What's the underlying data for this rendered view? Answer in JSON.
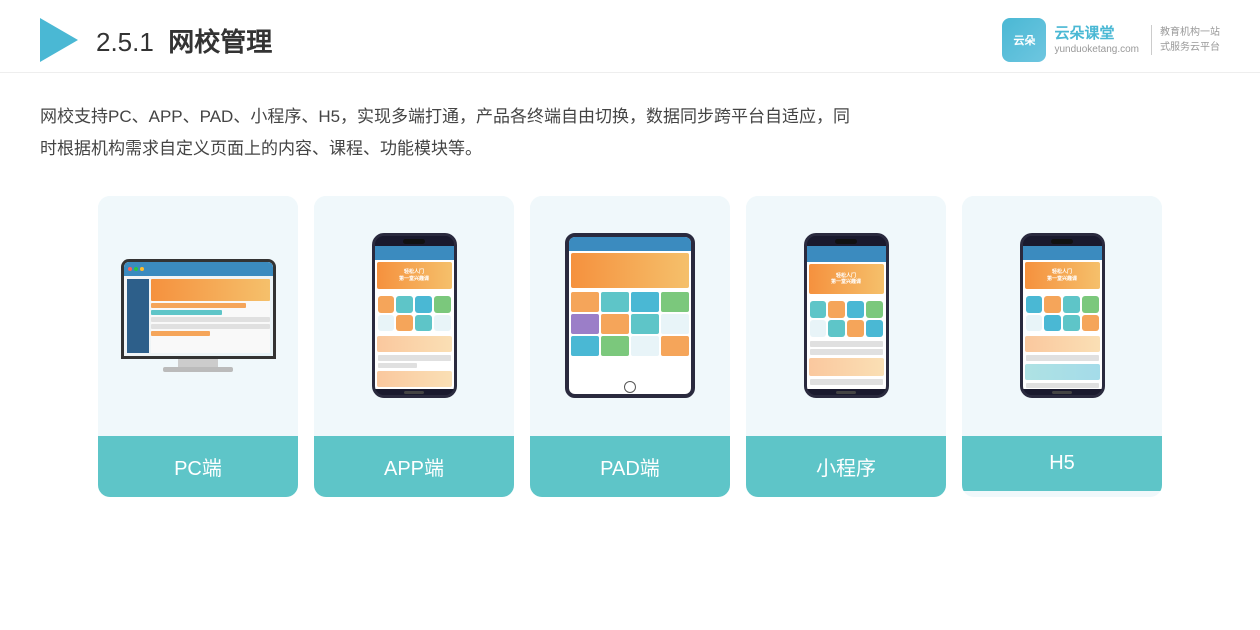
{
  "header": {
    "section_number": "2.5.1",
    "title_plain": "网校管理",
    "logo_name": "云朵课堂",
    "logo_url": "yunduoketang.com",
    "logo_tagline_line1": "教育机构一站",
    "logo_tagline_line2": "式服务云平台"
  },
  "description": {
    "text": "网校支持PC、APP、PAD、小程序、H5，实现多端打通，产品各终端自由切换，数据同步跨平台自适应，同时根据机构需求自定义页面上的内容、课程、功能模块等。"
  },
  "cards": [
    {
      "id": "pc",
      "label": "PC端"
    },
    {
      "id": "app",
      "label": "APP端"
    },
    {
      "id": "pad",
      "label": "PAD端"
    },
    {
      "id": "miniprogram",
      "label": "小程序"
    },
    {
      "id": "h5",
      "label": "H5"
    }
  ]
}
